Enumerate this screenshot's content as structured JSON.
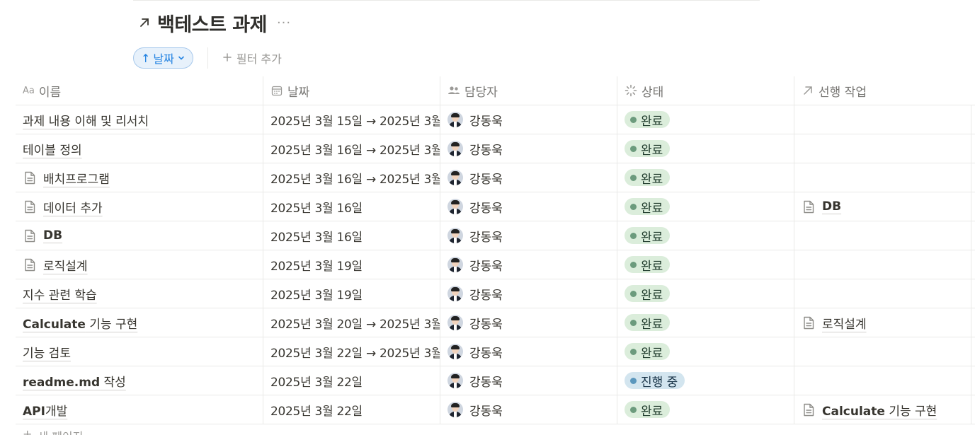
{
  "page": {
    "title": "백테스트 과제",
    "title_icon": "arrow-up-right-icon",
    "more_icon": "ellipsis-icon",
    "more_label": "···"
  },
  "toolbar": {
    "sort_arrow": "↑",
    "sort_label": "날짜",
    "add_filter_label": "필터 추가"
  },
  "columns": [
    {
      "label": "이름",
      "icon": "text-type-icon",
      "icon_text": "Aa"
    },
    {
      "label": "날짜",
      "icon": "calendar-icon"
    },
    {
      "label": "담당자",
      "icon": "people-icon"
    },
    {
      "label": "상태",
      "icon": "status-spinner-icon"
    },
    {
      "label": "선행 작업",
      "icon": "arrow-up-right-icon"
    }
  ],
  "rows": [
    {
      "name": "과제 내용 이해 및 리서치",
      "doc": false,
      "date": "2025년 3월 15일 → 2025년 3월",
      "assignee": "강동욱",
      "status": "완료",
      "prereq": ""
    },
    {
      "name": "테이블 정의",
      "doc": false,
      "date": "2025년 3월 16일 → 2025년 3월",
      "assignee": "강동욱",
      "status": "완료",
      "prereq": ""
    },
    {
      "name": "배치프로그램",
      "doc": true,
      "date": "2025년 3월 16일 → 2025년 3월",
      "assignee": "강동욱",
      "status": "완료",
      "prereq": ""
    },
    {
      "name": "데이터 추가",
      "doc": true,
      "date": "2025년 3월 16일",
      "assignee": "강동욱",
      "status": "완료",
      "prereq": "DB"
    },
    {
      "name": "DB",
      "doc": true,
      "date": "2025년 3월 16일",
      "assignee": "강동욱",
      "status": "완료",
      "prereq": ""
    },
    {
      "name": "로직설계",
      "doc": true,
      "date": "2025년 3월 19일",
      "assignee": "강동욱",
      "status": "완료",
      "prereq": ""
    },
    {
      "name": "지수 관련 학습",
      "doc": false,
      "date": "2025년 3월 19일",
      "assignee": "강동욱",
      "status": "완료",
      "prereq": ""
    },
    {
      "name_en": "Calculate",
      "name": " 기능 구현",
      "doc": false,
      "date": "2025년 3월 20일 → 2025년 3월",
      "assignee": "강동욱",
      "status": "완료",
      "prereq": "로직설계"
    },
    {
      "name": "기능 검토",
      "doc": false,
      "date": "2025년 3월 22일 → 2025년 3월",
      "assignee": "강동욱",
      "status": "완료",
      "prereq": ""
    },
    {
      "name_en": "readme.md",
      "name": " 작성",
      "doc": false,
      "date": "2025년 3월 22일",
      "assignee": "강동욱",
      "status": "진행 중",
      "prereq": ""
    },
    {
      "name_en": "API",
      "name": "개발",
      "doc": false,
      "date": "2025년 3월 22일",
      "assignee": "강동욱",
      "status": "완료",
      "prereq_en": "Calculate",
      "prereq": " 기능 구현"
    }
  ],
  "footer": {
    "new_page_label": "새 페이지"
  },
  "colors": {
    "accent": "#2383e2",
    "status_done_bg": "#dbeddb",
    "status_progress_bg": "#d3e5ef"
  }
}
